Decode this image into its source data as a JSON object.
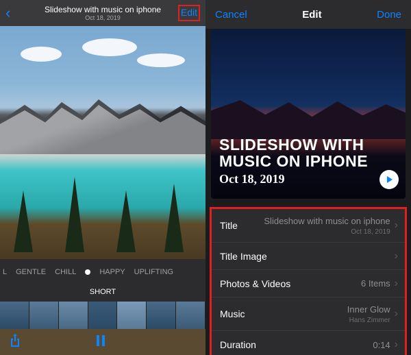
{
  "left": {
    "title": "Slideshow with music on iphone",
    "subtitle": "Oct 18, 2019",
    "edit": "Edit",
    "moods": [
      "L",
      "GENTLE",
      "CHILL",
      "HAPPY",
      "UPLIFTING"
    ],
    "length_label": "SHORT"
  },
  "right": {
    "cancel": "Cancel",
    "header_title": "Edit",
    "done": "Done",
    "hero_title": "SLIDESHOW WITH MUSIC ON IPHONE",
    "hero_date": "Oct 18, 2019",
    "rows": {
      "title": {
        "label": "Title",
        "value": "Slideshow with music on iphone",
        "sub": "Oct 18, 2019"
      },
      "title_image": {
        "label": "Title Image",
        "value": ""
      },
      "photos": {
        "label": "Photos & Videos",
        "value": "6 Items"
      },
      "music": {
        "label": "Music",
        "value": "Inner Glow",
        "sub": "Hans Zimmer"
      },
      "duration": {
        "label": "Duration",
        "value": "0:14"
      }
    }
  }
}
